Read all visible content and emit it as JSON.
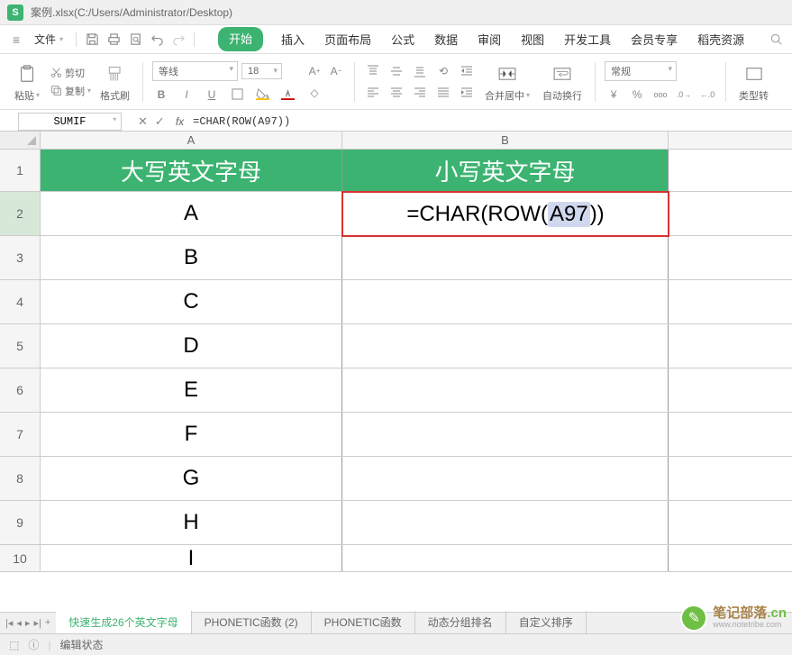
{
  "title_bar": {
    "app_badge": "S",
    "title": "案例.xlsx(C:/Users/Administrator/Desktop)"
  },
  "menu": {
    "hamburger": "≡",
    "file_label": "文件",
    "tabs": [
      "开始",
      "插入",
      "页面布局",
      "公式",
      "数据",
      "审阅",
      "视图",
      "开发工具",
      "会员专享",
      "稻壳资源"
    ],
    "active_tab": "开始"
  },
  "ribbon": {
    "paste_label": "粘贴",
    "cut_label": "剪切",
    "copy_label": "复制",
    "format_painter_label": "格式刷",
    "font_name": "等线",
    "font_size": "18",
    "bold": "B",
    "italic": "I",
    "underline": "U",
    "merge_label": "合并居中",
    "wrap_label": "自动换行",
    "number_format": "常规",
    "type_convert_label": "类型转"
  },
  "formula_bar": {
    "name_box": "SUMIF",
    "fx": "fx",
    "formula": "=CHAR(ROW(A97))"
  },
  "sheet": {
    "columns": [
      "A",
      "B"
    ],
    "header_a": "大写英文字母",
    "header_b": "小写英文字母",
    "data": [
      "A",
      "B",
      "C",
      "D",
      "E",
      "F",
      "G",
      "H",
      "I"
    ],
    "active_cell_parts": {
      "prefix": "=CHAR(ROW(",
      "ref": "A97",
      "suffix": "))"
    }
  },
  "sheet_tabs": {
    "tabs": [
      "快速生成26个英文字母",
      "PHONETIC函数 (2)",
      "PHONETIC函数",
      "动态分组排名",
      "自定义排序"
    ],
    "active": "快速生成26个英文字母",
    "add": "+"
  },
  "status_bar": {
    "status": "编辑状态"
  },
  "watermark": {
    "main": "笔记部落",
    "sub": "www.notetribe.com",
    "suffix": ".cn"
  }
}
